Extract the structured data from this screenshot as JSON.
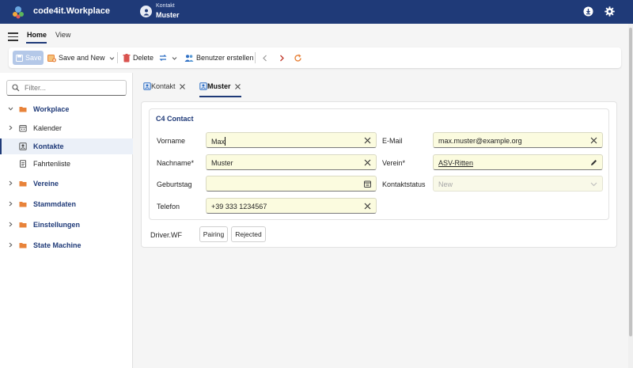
{
  "app": {
    "title": "code4it.Workplace",
    "context_type": "Kontakt",
    "context_name": "Muster"
  },
  "ribbon": {
    "tabs": [
      "Home",
      "View"
    ],
    "active_tab": "Home"
  },
  "toolbar": {
    "save_label": "Save",
    "save_and_new_label": "Save and New",
    "delete_label": "Delete",
    "create_user_label": "Benutzer erstellen"
  },
  "sidebar": {
    "filter_placeholder": "Filter...",
    "items": [
      {
        "label": "Workplace",
        "icon": "folder-icon",
        "expanded": true
      },
      {
        "label": "Kalender",
        "icon": "calendar-icon"
      },
      {
        "label": "Kontakte",
        "icon": "contact-card-icon",
        "selected": true
      },
      {
        "label": "Fahrtenliste",
        "icon": "document-icon"
      },
      {
        "label": "Vereine",
        "icon": "folder-icon"
      },
      {
        "label": "Stammdaten",
        "icon": "folder-icon"
      },
      {
        "label": "Einstellungen",
        "icon": "folder-icon"
      },
      {
        "label": "State Machine",
        "icon": "folder-icon"
      }
    ]
  },
  "content_tabs": [
    {
      "label": "Kontakt",
      "active": false
    },
    {
      "label": "Muster",
      "active": true
    }
  ],
  "form": {
    "section_title": "C4 Contact",
    "fields": {
      "vorname": {
        "label": "Vorname",
        "value": "Max"
      },
      "nachname": {
        "label": "Nachname*",
        "value": "Muster"
      },
      "geburtstag": {
        "label": "Geburtstag",
        "value": ""
      },
      "telefon": {
        "label": "Telefon",
        "value": "+39 333 1234567"
      },
      "email": {
        "label": "E-Mail",
        "value": "max.muster@example.org"
      },
      "verein": {
        "label": "Verein*",
        "value": "ASV-Ritten"
      },
      "kontaktstatus": {
        "label": "Kontaktstatus",
        "value": "New"
      }
    }
  },
  "workflow": {
    "label": "Driver.WF",
    "buttons": [
      "Pairing",
      "Rejected"
    ]
  },
  "colors": {
    "topbar": "#1f3a78",
    "field_bg": "#fbfbdf",
    "accent": "#1f3a78",
    "folder": "#e8833a",
    "delete": "#d9534f",
    "refresh": "#e8833a"
  }
}
